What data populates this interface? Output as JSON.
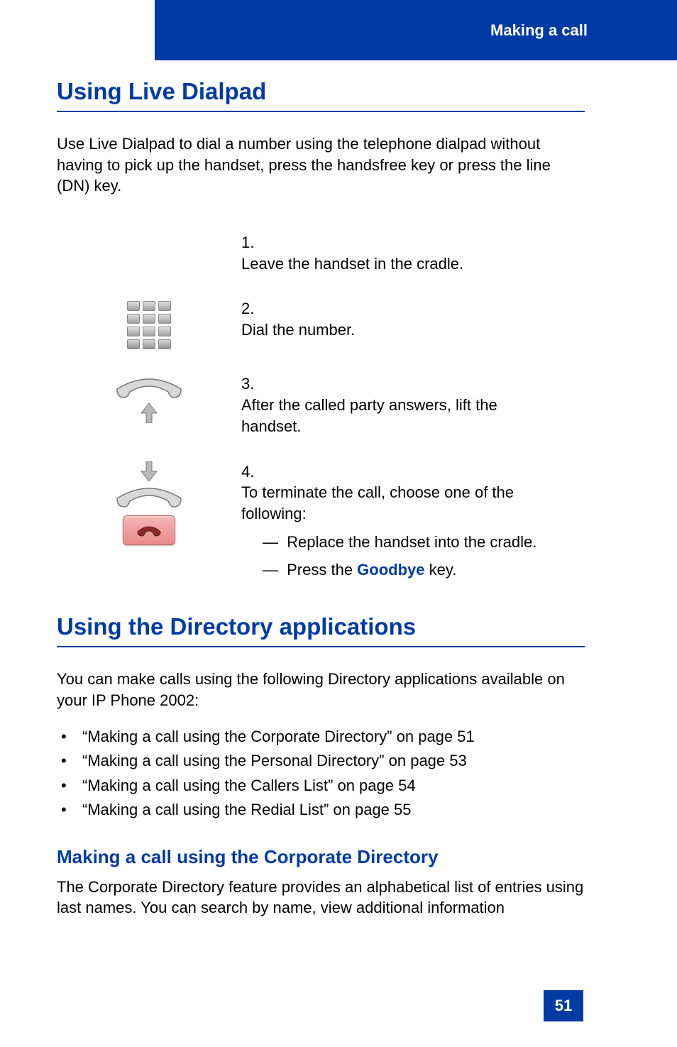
{
  "header": {
    "label": "Making a call"
  },
  "section1": {
    "heading": "Using Live Dialpad",
    "intro": "Use Live Dialpad to dial a number using the telephone dialpad without having to pick up the handset, press the handsfree key or press the line (DN) key."
  },
  "steps": {
    "s1": {
      "num": "1.",
      "text": "Leave the handset in the cradle."
    },
    "s2": {
      "num": "2.",
      "text": "Dial the number."
    },
    "s3": {
      "num": "3.",
      "text": "After the called party answers, lift the handset."
    },
    "s4": {
      "num": "4.",
      "text": "To terminate the call, choose one of the following:",
      "sub1_dash": "—",
      "sub1_text": "Replace the handset into the cradle.",
      "sub2_dash": "—",
      "sub2_prefix": "Press the ",
      "sub2_goodbye": "Goodbye",
      "sub2_suffix": " key."
    }
  },
  "section2": {
    "heading": "Using the Directory applications",
    "intro": "You can make calls using the following Directory applications available on your IP Phone 2002:",
    "bullets": [
      "“Making a call using the Corporate Directory” on page 51",
      "“Making a call using the Personal Directory” on page 53",
      "“Making a call using the Callers List” on page 54",
      "“Making a call using the Redial List” on page 55"
    ]
  },
  "section3": {
    "heading": "Making a call using the Corporate Directory",
    "body": "The Corporate Directory feature provides an alphabetical list of entries using last names. You can search by name, view additional information"
  },
  "pageNumber": "51"
}
